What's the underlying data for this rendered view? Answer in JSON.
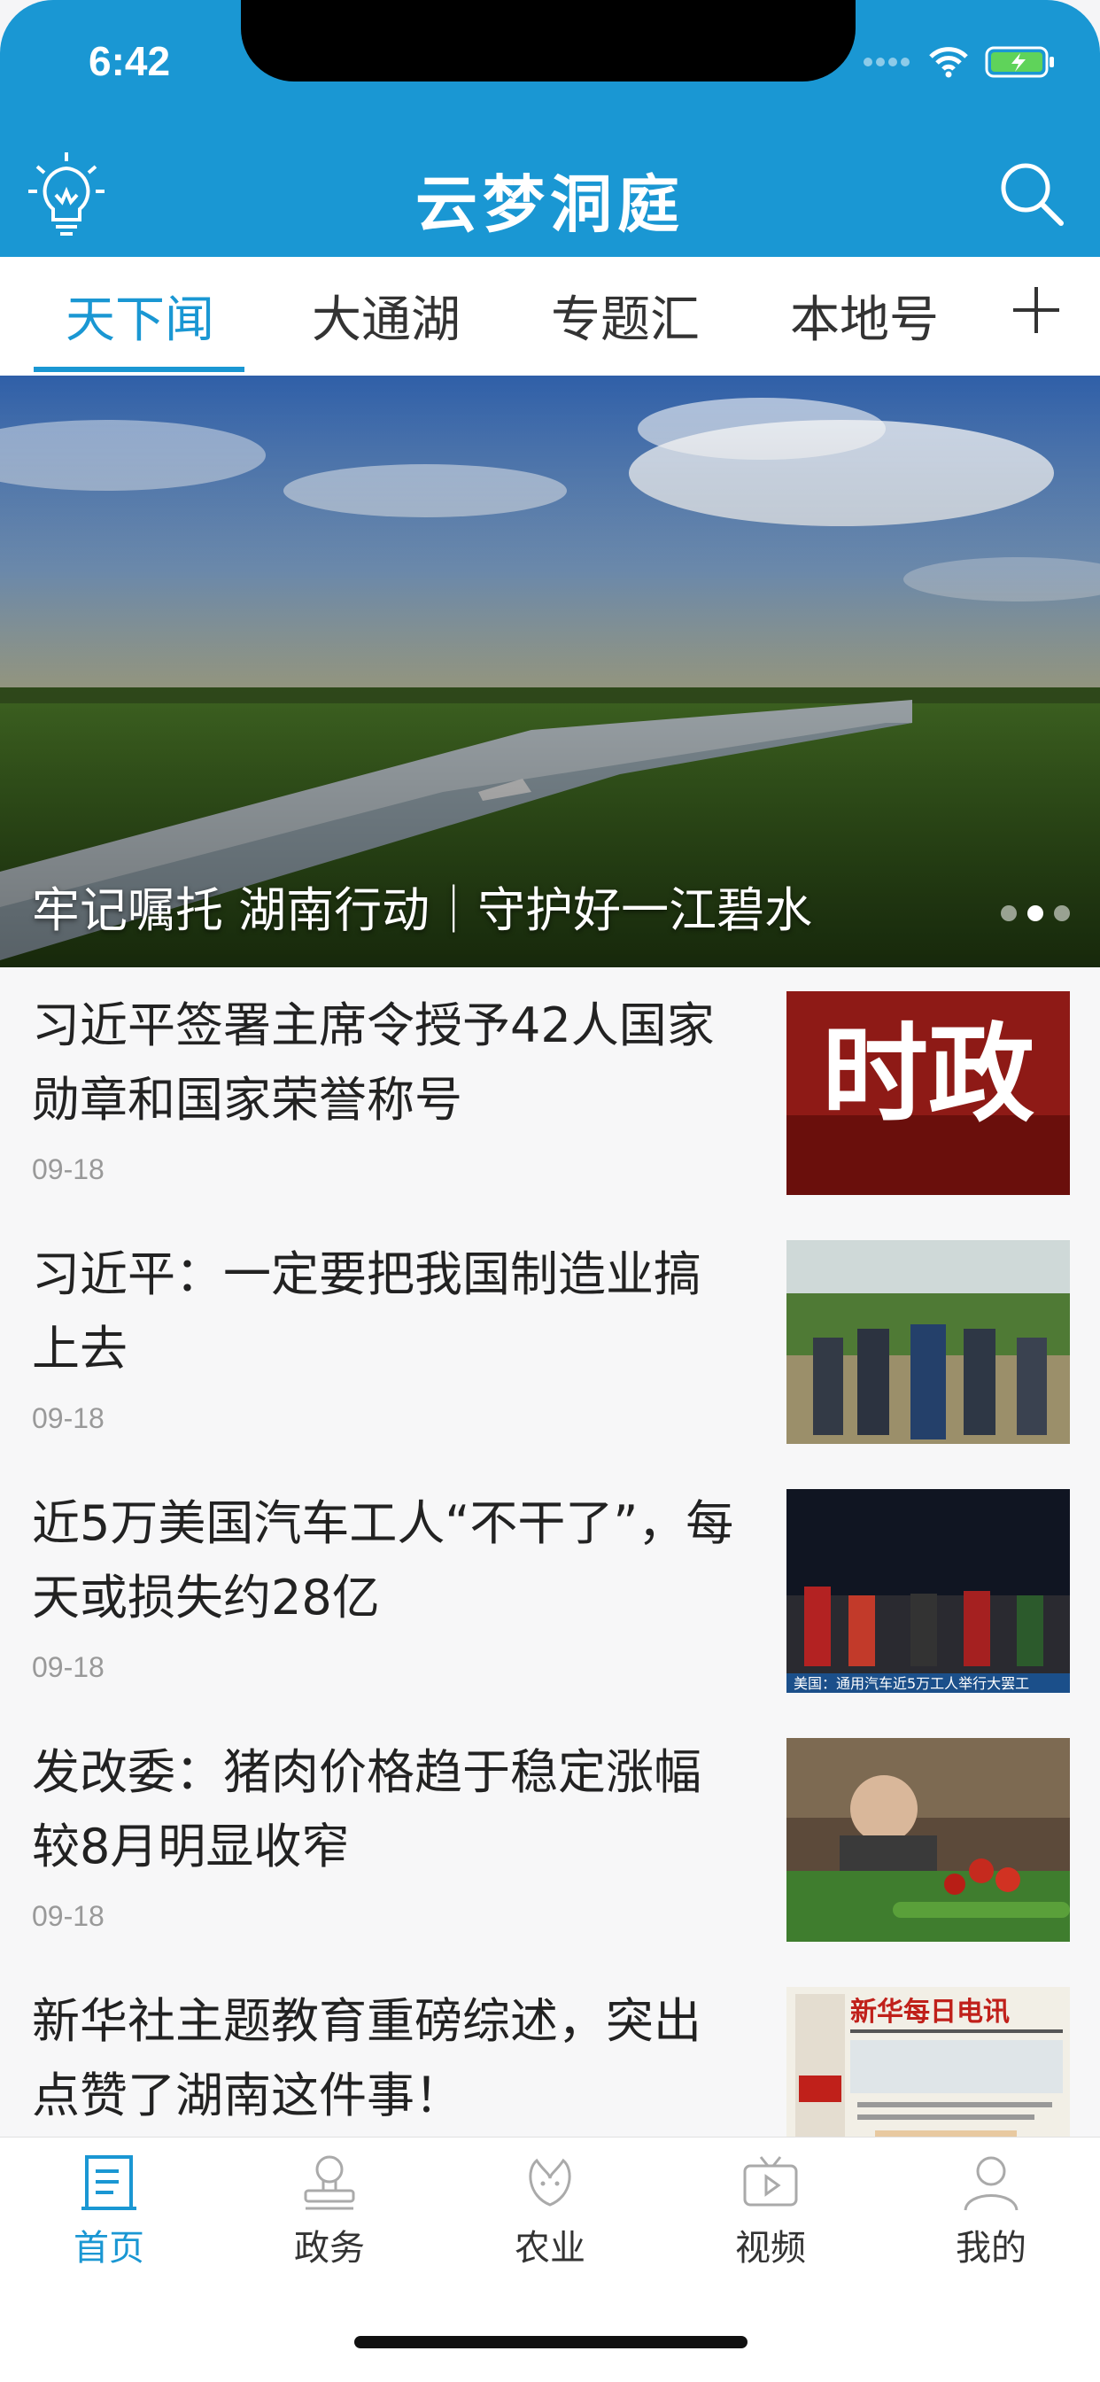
{
  "status": {
    "time": "6:42"
  },
  "header": {
    "title": "云梦洞庭"
  },
  "tabs": [
    {
      "label": "天下闻",
      "active": true
    },
    {
      "label": "大通湖",
      "active": false
    },
    {
      "label": "专题汇",
      "active": false
    },
    {
      "label": "本地号",
      "active": false
    }
  ],
  "hero": {
    "caption": "牢记嘱托 湖南行动｜守护好一江碧水",
    "pages": 3,
    "current_page": 2
  },
  "news": [
    {
      "title": "习近平签署主席令授予42人国家勋章和国家荣誉称号",
      "date": "09-18",
      "thumb_text": "时政"
    },
    {
      "title": "习近平：一定要把我国制造业搞上去",
      "date": "09-18"
    },
    {
      "title": "近5万美国汽车工人“不干了”，每天或损失约28亿",
      "date": "09-18",
      "thumb_text": "美国：通用汽车近5万工人举行大罢工"
    },
    {
      "title": "发改委：猪肉价格趋于稳定涨幅较8月明显收窄",
      "date": "09-18"
    },
    {
      "title": "新华社主题教育重磅综述，突出点赞了湖南这件事！",
      "date": "",
      "thumb_text": "新华每日电讯"
    }
  ],
  "bottom_nav": [
    {
      "label": "首页",
      "icon": "news-page-icon",
      "active": true
    },
    {
      "label": "政务",
      "icon": "stamp-icon",
      "active": false
    },
    {
      "label": "农业",
      "icon": "leaf-icon",
      "active": false
    },
    {
      "label": "视频",
      "icon": "tv-icon",
      "active": false
    },
    {
      "label": "我的",
      "icon": "person-icon",
      "active": false
    }
  ],
  "colors": {
    "accent": "#1a97d3"
  }
}
